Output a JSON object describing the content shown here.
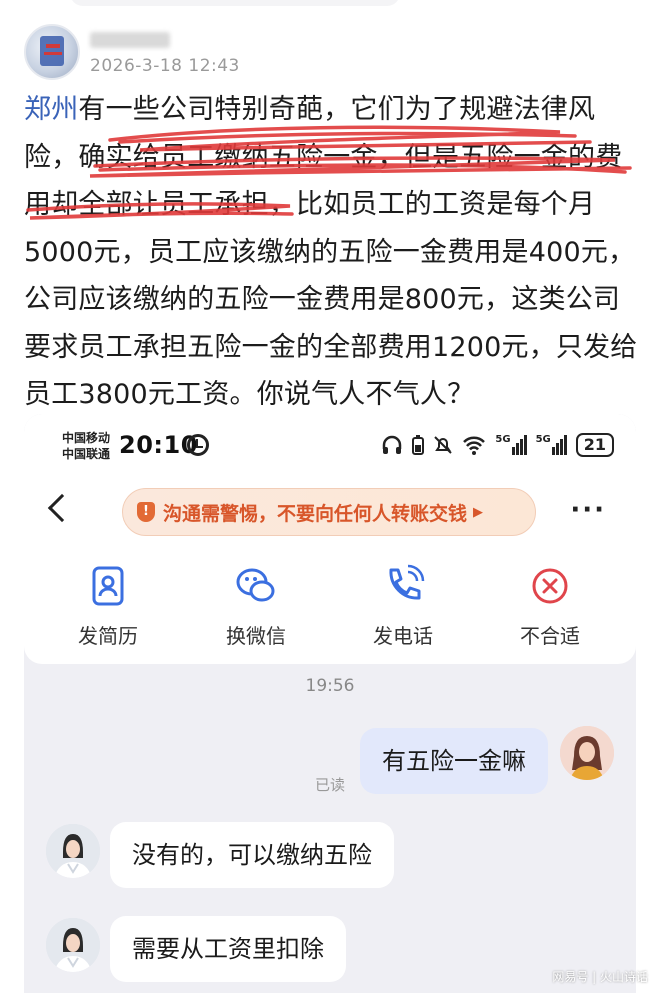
{
  "post": {
    "date": "2026-3-18 12:43",
    "location_link": "郑州",
    "text": "有一些公司特别奇葩，它们为了规避法律风险，确实给员工缴纳五险一金，但是五险一金的费用却全部让员工承担，比如员工的工资是每个月5000元，员工应该缴纳的五险一金费用是400元，公司应该缴纳的五险一金费用是800元，这类公司要求员工承担五险一金的全部费用1200元，只发给员工3800元工资。你说气人不气人？",
    "highlight_color": "#e03a3a"
  },
  "chat": {
    "status_bar": {
      "carrier_1": "中国移动",
      "carrier_2": "中国联通",
      "time": "20:10",
      "network_1": "5G",
      "network_2": "5G",
      "battery": "21"
    },
    "warning_banner": "沟通需警惕，不要向任何人转账交钱",
    "actions": [
      {
        "label": "发简历",
        "icon": "resume-icon",
        "color": "#3b6fe0"
      },
      {
        "label": "换微信",
        "icon": "wechat-icon",
        "color": "#3b6fe0"
      },
      {
        "label": "发电话",
        "icon": "phone-icon",
        "color": "#3b6fe0"
      },
      {
        "label": "不合适",
        "icon": "close-circle-icon",
        "color": "#e0454b"
      }
    ],
    "time_divider": "19:56",
    "messages": [
      {
        "from": "me",
        "text": "有五险一金嘛",
        "status": "已读"
      },
      {
        "from": "them",
        "text": "没有的，可以缴纳五险"
      },
      {
        "from": "them",
        "text": "需要从工资里扣除"
      }
    ]
  },
  "watermark": "网易号 | 火山诗话"
}
